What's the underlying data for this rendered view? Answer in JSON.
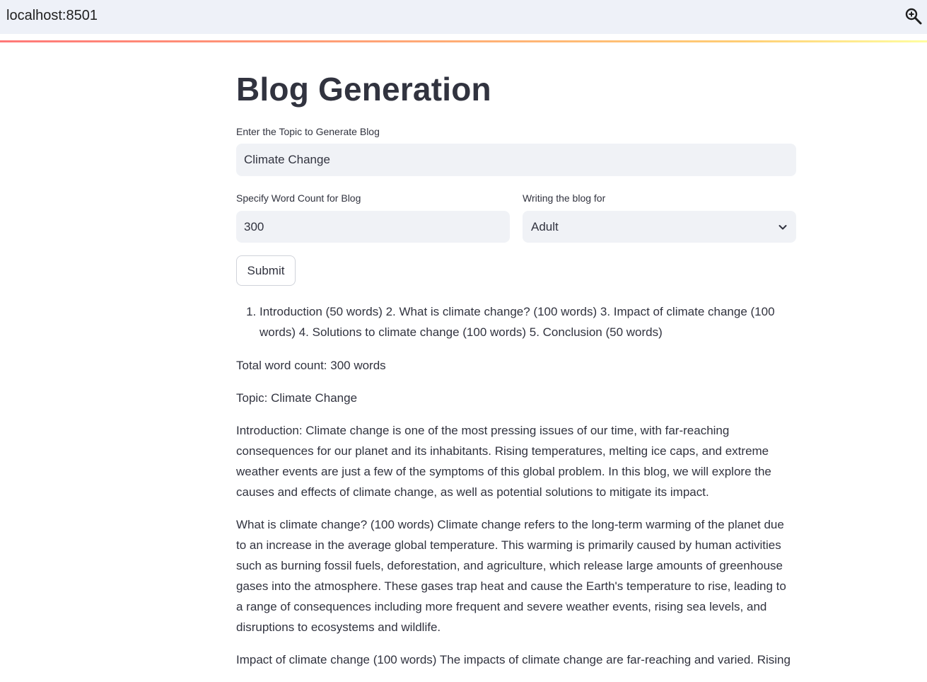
{
  "browser": {
    "url": "localhost:8501"
  },
  "page": {
    "title": "Blog Generation"
  },
  "topic_field": {
    "label": "Enter the Topic to Generate Blog",
    "value": "Climate Change"
  },
  "word_count_field": {
    "label": "Specify Word Count for Blog",
    "value": "300"
  },
  "audience_field": {
    "label": "Writing the blog for",
    "selected": "Adult"
  },
  "submit": {
    "label": "Submit"
  },
  "output": {
    "outline_items": [
      "Introduction (50 words) 2. What is climate change? (100 words) 3. Impact of climate change (100 words) 4. Solutions to climate change (100 words) 5. Conclusion (50 words)"
    ],
    "paragraphs": [
      "Total word count: 300 words",
      "Topic: Climate Change",
      "Introduction: Climate change is one of the most pressing issues of our time, with far-reaching consequences for our planet and its inhabitants. Rising temperatures, melting ice caps, and extreme weather events are just a few of the symptoms of this global problem. In this blog, we will explore the causes and effects of climate change, as well as potential solutions to mitigate its impact.",
      "What is climate change? (100 words) Climate change refers to the long-term warming of the planet due to an increase in the average global temperature. This warming is primarily caused by human activities such as burning fossil fuels, deforestation, and agriculture, which release large amounts of greenhouse gases into the atmosphere. These gases trap heat and cause the Earth's temperature to rise, leading to a range of consequences including more frequent and severe weather events, rising sea levels, and disruptions to ecosystems and wildlife.",
      "Impact of climate change (100 words) The impacts of climate change are far-reaching and varied. Rising"
    ]
  },
  "colors": {
    "accent_red": "#ff4b4b",
    "accent_yellow": "#ffbd45",
    "input_bg": "#f0f2f6",
    "text": "#31333f",
    "browser_bar": "#eef1f8"
  },
  "icons": {
    "zoom": "zoom-icon",
    "select_chevron": "chevron-down-icon"
  }
}
